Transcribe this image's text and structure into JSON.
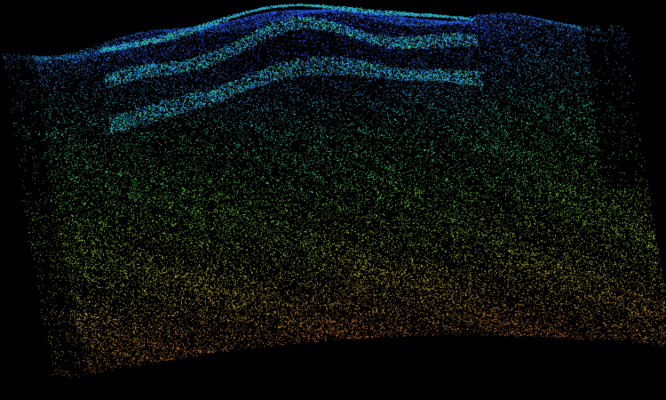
{
  "scene": {
    "background_color": "#000000",
    "colormap": [
      "#cc2a1a",
      "#c9a72c",
      "#5bbf2a",
      "#23c8b8",
      "#2a5cff"
    ]
  }
}
